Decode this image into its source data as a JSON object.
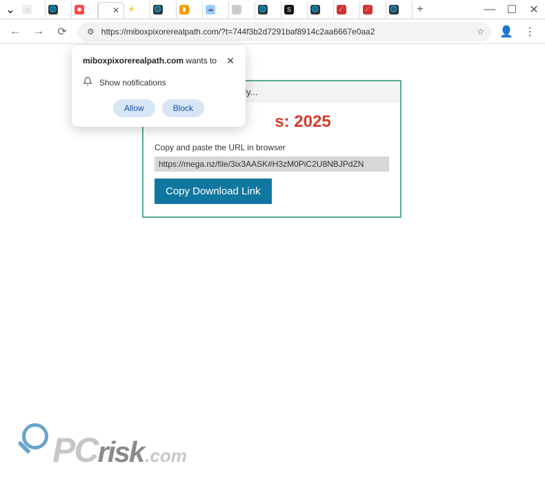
{
  "window": {
    "new_tab": "+",
    "minimize": "—",
    "maximize": "☐",
    "close": "✕",
    "tabs_dropdown": "⌄"
  },
  "tabs": [
    {
      "favicon_bg": "#eee",
      "favicon_text": "◌",
      "active": false
    },
    {
      "favicon_bg": "#333",
      "favicon_text": "🌐",
      "active": false
    },
    {
      "favicon_bg": "#f44",
      "favicon_text": "◉",
      "active": false
    },
    {
      "favicon_bg": "#fff",
      "favicon_text": "",
      "close_label": "✕",
      "active": true
    },
    {
      "favicon_bg": "#fff",
      "favicon_text": "⚡",
      "active": false
    },
    {
      "favicon_bg": "#333",
      "favicon_text": "🌐",
      "active": false
    },
    {
      "favicon_bg": "#f90",
      "favicon_text": "▮",
      "active": false
    },
    {
      "favicon_bg": "#9cf",
      "favicon_text": "☁",
      "active": false
    },
    {
      "favicon_bg": "#ccc",
      "favicon_text": "◌",
      "active": false
    },
    {
      "favicon_bg": "#333",
      "favicon_text": "🌐",
      "active": false
    },
    {
      "favicon_bg": "#111",
      "favicon_text": "S",
      "active": false
    },
    {
      "favicon_bg": "#333",
      "favicon_text": "🌐",
      "active": false
    },
    {
      "favicon_bg": "#c33",
      "favicon_text": "☄",
      "active": false
    },
    {
      "favicon_bg": "#c33",
      "favicon_text": "☄",
      "active": false
    },
    {
      "favicon_bg": "#333",
      "favicon_text": "🌐",
      "active": false
    }
  ],
  "toolbar": {
    "back": "←",
    "forward": "→",
    "reload": "⟳",
    "site_chip": "⚙",
    "url": "https://miboxpixorerealpath.com/?t=744f3b2d7291baf8914c2aa6667e0aa2",
    "star": "☆",
    "profile": "👤",
    "menu": "⋮"
  },
  "permission": {
    "domain": "miboxpixorerealpath.com",
    "wants_suffix": " wants to",
    "item_label": "Show notifications",
    "bell": "🔔",
    "allow": "Allow",
    "block": "Block",
    "close": "✕"
  },
  "page": {
    "header_text": "dy...",
    "red_text": "s: 2025",
    "hint": "Copy and paste the URL in browser",
    "download_url": "https://mega.nz/file/3ix3AASK#H3zM0PiC2U8NBJPdZN",
    "copy_button": "Copy Download Link"
  },
  "watermark": {
    "p": "P",
    "c": "C",
    "risk": "risk",
    "com": ".com"
  }
}
